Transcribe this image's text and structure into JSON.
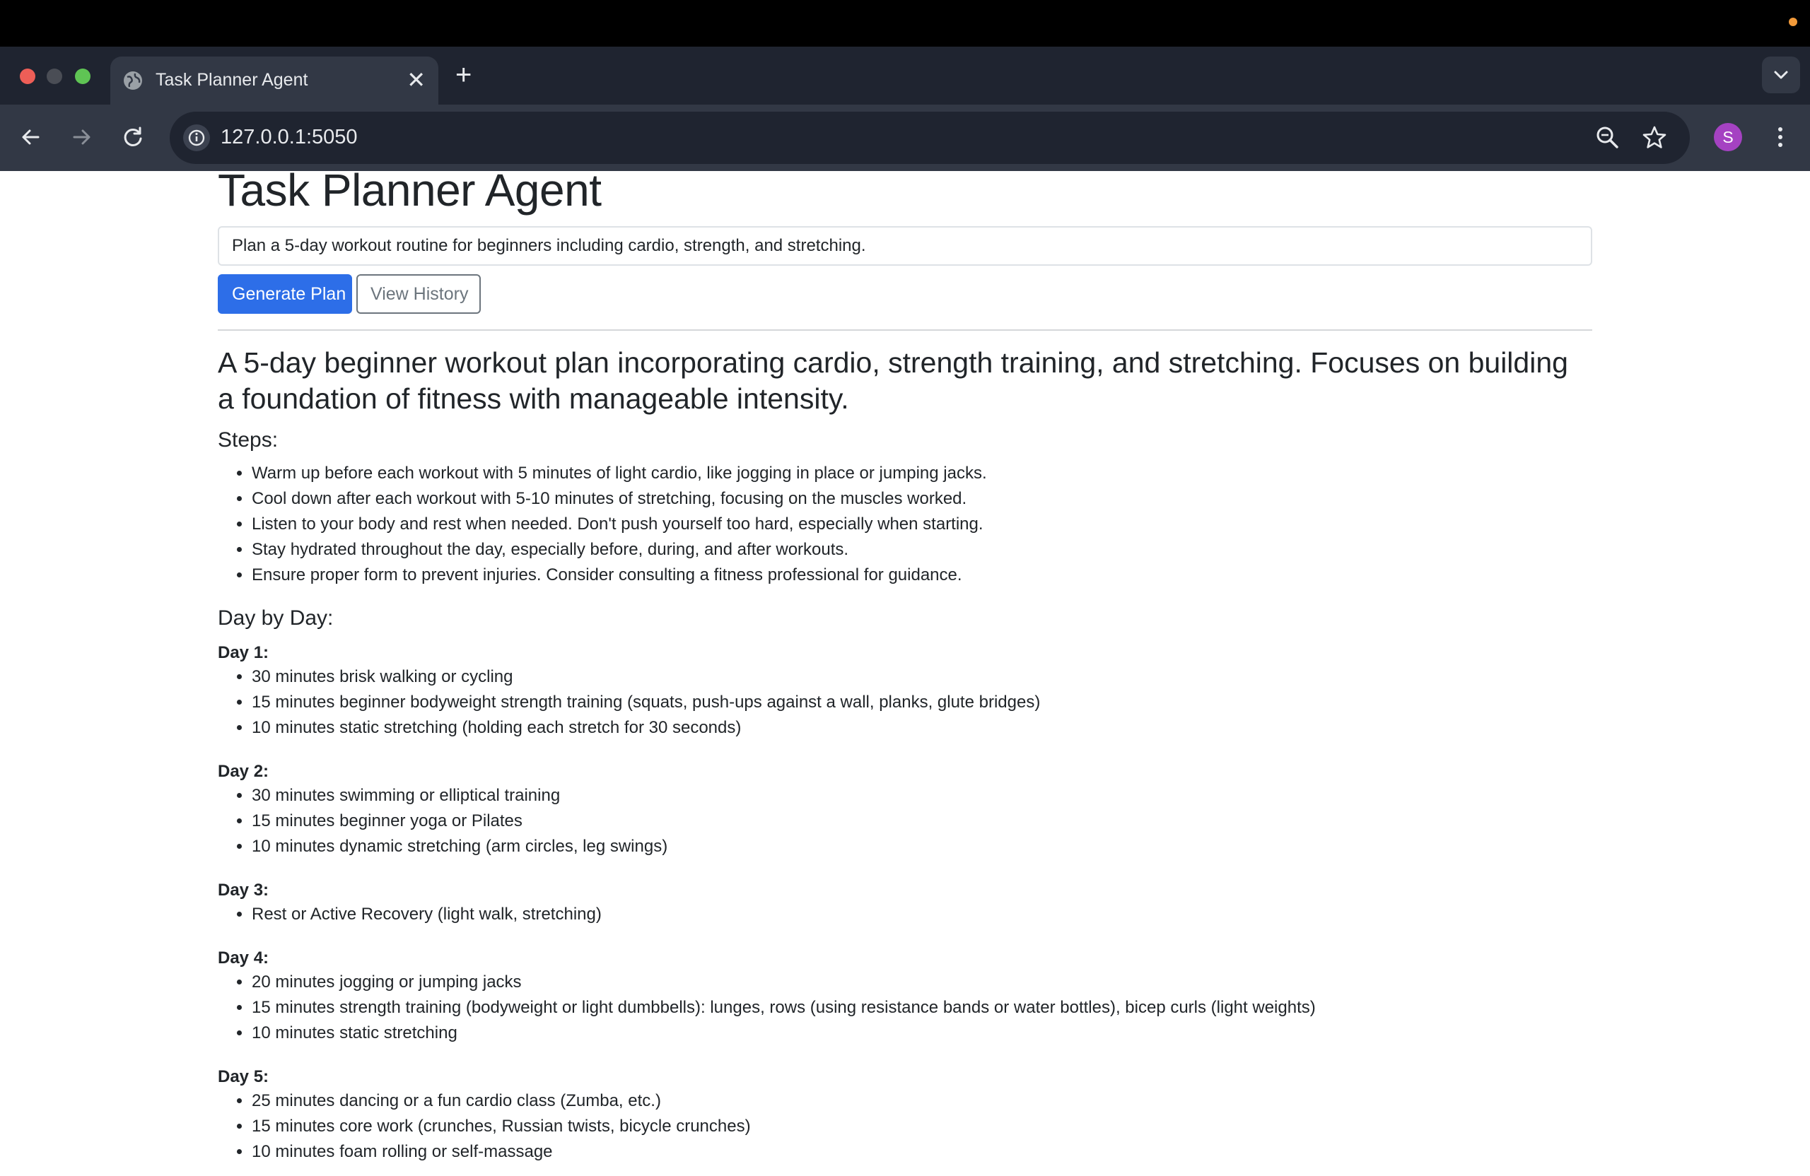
{
  "browser": {
    "tab_title": "Task Planner Agent",
    "new_tab_label": "+",
    "url": "127.0.0.1:5050",
    "profile_initial": "S"
  },
  "app": {
    "title": "Task Planner Agent",
    "task_input_value": "Plan a 5-day workout routine for beginners including cardio, strength, and stretching.",
    "generate_button": "Generate Plan",
    "history_button": "View History"
  },
  "plan": {
    "summary": "A 5-day beginner workout plan incorporating cardio, strength training, and stretching. Focuses on building a foundation of fitness with manageable intensity.",
    "steps_heading": "Steps:",
    "steps": [
      "Warm up before each workout with 5 minutes of light cardio, like jogging in place or jumping jacks.",
      "Cool down after each workout with 5-10 minutes of stretching, focusing on the muscles worked.",
      "Listen to your body and rest when needed. Don't push yourself too hard, especially when starting.",
      "Stay hydrated throughout the day, especially before, during, and after workouts.",
      "Ensure proper form to prevent injuries. Consider consulting a fitness professional for guidance."
    ],
    "days_heading": "Day by Day:",
    "days": [
      {
        "label": "Day 1:",
        "items": [
          "30 minutes brisk walking or cycling",
          "15 minutes beginner bodyweight strength training (squats, push-ups against a wall, planks, glute bridges)",
          "10 minutes static stretching (holding each stretch for 30 seconds)"
        ]
      },
      {
        "label": "Day 2:",
        "items": [
          "30 minutes swimming or elliptical training",
          "15 minutes beginner yoga or Pilates",
          "10 minutes dynamic stretching (arm circles, leg swings)"
        ]
      },
      {
        "label": "Day 3:",
        "items": [
          "Rest or Active Recovery (light walk, stretching)"
        ]
      },
      {
        "label": "Day 4:",
        "items": [
          "20 minutes jogging or jumping jacks",
          "15 minutes strength training (bodyweight or light dumbbells): lunges, rows (using resistance bands or water bottles), bicep curls (light weights)",
          "10 minutes static stretching"
        ]
      },
      {
        "label": "Day 5:",
        "items": [
          "25 minutes dancing or a fun cardio class (Zumba, etc.)",
          "15 minutes core work (crunches, Russian twists, bicycle crunches)",
          "10 minutes foam rolling or self-massage"
        ]
      }
    ]
  },
  "colors": {
    "primary_button": "#2d6ee8",
    "browser_dark": "#1f2430",
    "browser_toolbar": "#323845",
    "avatar": "#a542c2"
  },
  "icons": [
    "globe-icon",
    "close-icon",
    "plus-icon",
    "chevron-down-icon",
    "back-arrow-icon",
    "forward-arrow-icon",
    "reload-icon",
    "info-icon",
    "zoom-icon",
    "star-icon",
    "more-vert-icon"
  ]
}
